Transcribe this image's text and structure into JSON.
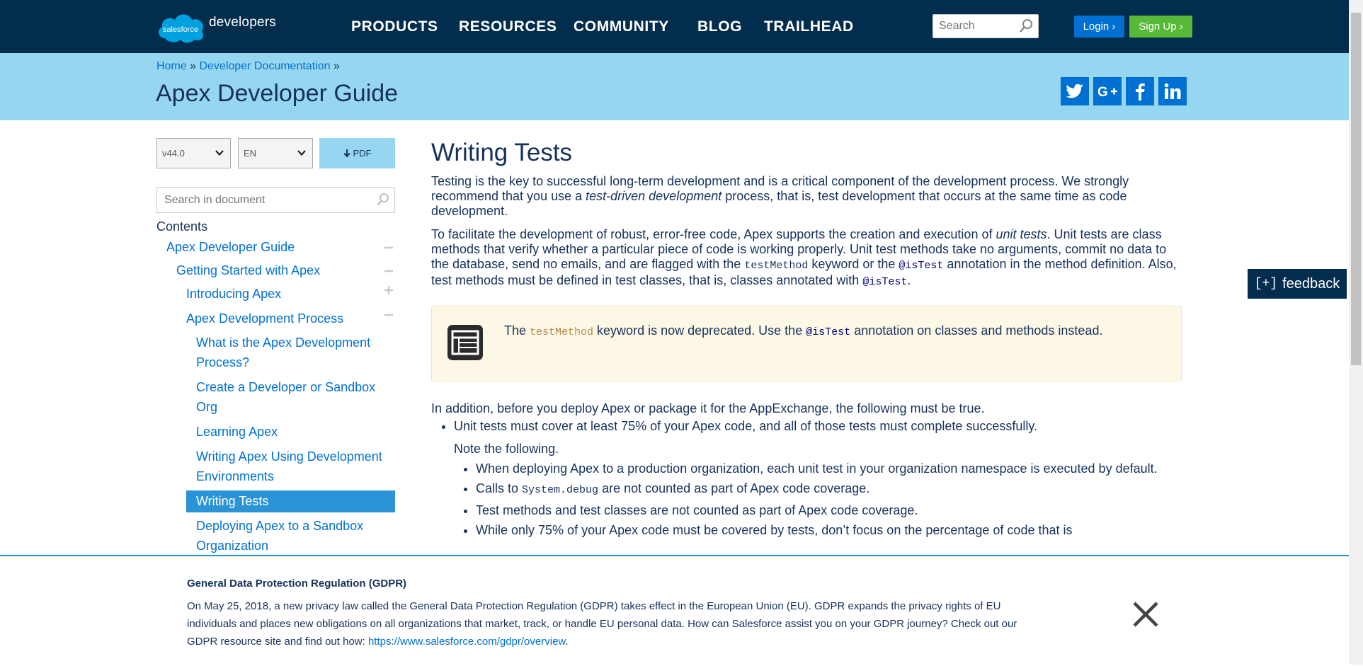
{
  "header": {
    "logo_cloud_text": "salesforce",
    "logo_word": "developers",
    "nav": [
      "PRODUCTS",
      "RESOURCES",
      "COMMUNITY",
      "BLOG",
      "TRAILHEAD"
    ],
    "search_placeholder": "Search",
    "login_label": "Login ›",
    "signup_label": "Sign Up ›"
  },
  "banner": {
    "breadcrumb": [
      "Home",
      "Developer Documentation"
    ],
    "breadcrumb_sep": "»",
    "title": "Apex Developer Guide",
    "social_icons": [
      "twitter-icon",
      "google-plus-icon",
      "facebook-icon",
      "linkedin-icon"
    ]
  },
  "sidebar": {
    "version": "v44.0",
    "language": "EN",
    "pdf_label": "PDF",
    "search_placeholder": "Search in document",
    "contents_label": "Contents",
    "toc": [
      {
        "label": "Apex Developer Guide",
        "toggle": "−"
      },
      {
        "label": "Getting Started with Apex",
        "toggle": "−"
      },
      {
        "label": "Introducing Apex",
        "toggle": "+"
      },
      {
        "label": "Apex Development Process",
        "toggle": "−"
      },
      {
        "label": "What is the Apex Development Process?"
      },
      {
        "label": "Create a Developer or Sandbox Org"
      },
      {
        "label": "Learning Apex"
      },
      {
        "label": "Writing Apex Using Development Environments"
      },
      {
        "label": "Writing Tests",
        "active": true
      },
      {
        "label": "Deploying Apex to a Sandbox Organization"
      }
    ]
  },
  "main": {
    "title": "Writing Tests",
    "p1_a": "Testing is the key to successful long-term development and is a critical component of the development process. We strongly recommend that you use a ",
    "p1_em": "test-driven development",
    "p1_b": " process, that is, test development that occurs at the same time as code development.",
    "p2_a": "To facilitate the development of robust, error-free code, Apex supports the creation and execution of ",
    "p2_em": "unit tests",
    "p2_b": ". Unit tests are class methods that verify whether a particular piece of code is working properly. Unit test methods take no arguments, commit no data to the database, send no emails, and are flagged with the ",
    "p2_code1": "testMethod",
    "p2_c": " keyword or the ",
    "p2_code2": "@isTest",
    "p2_d": " annotation in the method definition. Also, test methods must be defined in test classes, that is, classes annotated with ",
    "p2_code3": "@isTest",
    "p2_e": ".",
    "note_a": "The ",
    "note_code1": "testMethod",
    "note_b": " keyword is now deprecated. Use the ",
    "note_code2": "@isTest",
    "note_c": " annotation on classes and methods instead.",
    "p3": "In addition, before you deploy Apex or package it for the AppExchange, the following must be true.",
    "bullet1": "Unit tests must cover at least 75% of your Apex code, and all of those tests must complete successfully.",
    "note_following": "Note the following.",
    "sub1": "When deploying Apex to a production organization, each unit test in your organization namespace is executed by default.",
    "sub2_a": "Calls to ",
    "sub2_code": "System.debug",
    "sub2_b": " are not counted as part of Apex code coverage.",
    "sub3": "Test methods and test classes are not counted as part of Apex code coverage.",
    "sub4": "While only 75% of your Apex code must be covered by tests, don’t focus on the percentage of code that is"
  },
  "feedback": {
    "label": "feedback",
    "prefix": "[+]"
  },
  "gdpr": {
    "title": "General Data Protection Regulation (GDPR)",
    "body": "On May 25, 2018, a new privacy law called the General Data Protection Regulation (GDPR) takes effect in the European Union (EU). GDPR expands the privacy rights of EU individuals and places new obligations on all organizations that market, track, or handle EU personal data. How can Salesforce assist you on your GDPR journey? Check out our GDPR resource site and find out how: ",
    "link": "https://www.salesforce.com/gdpr/overview",
    "link_suffix": "."
  },
  "colors": {
    "nav_bg": "#032d4d",
    "banner_bg": "#97d6f1",
    "link": "#0070d2",
    "active_bg": "#2a94d6",
    "login_bg": "#0070d2",
    "signup_bg": "#58b837",
    "note_bg": "#fdf8e6"
  }
}
